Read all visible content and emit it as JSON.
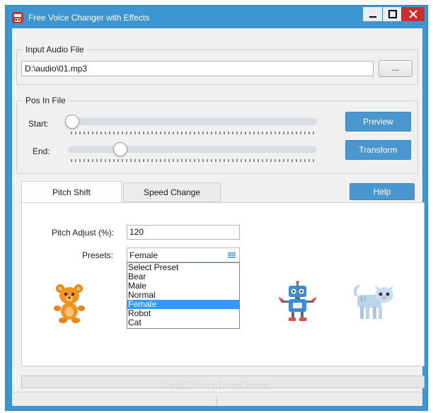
{
  "window": {
    "title": "Free Voice Changer with Effects",
    "accent_color": "#3d95d1"
  },
  "input_group": {
    "title": "Input Audio File",
    "file_path": "D:\\audio\\01.mp3",
    "browse_label": "..."
  },
  "pos_group": {
    "title": "Pos In File",
    "start_label": "Start:",
    "end_label": "End:",
    "start_value": 0.0,
    "end_value": 0.2
  },
  "buttons": {
    "preview": "Preview",
    "transform": "Transform",
    "help": "Help"
  },
  "tabs": [
    {
      "label": "Pitch Shift",
      "active": true
    },
    {
      "label": "Speed Change",
      "active": false
    }
  ],
  "pitch": {
    "adjust_label": "Pitch Adjust (%):",
    "adjust_value": "120",
    "presets_label": "Presets:",
    "selected_preset": "Female",
    "options": [
      "Select Preset",
      "Bear",
      "Male",
      "Normal",
      "Female",
      "Robot",
      "Cat"
    ]
  },
  "icons": [
    "bear-icon",
    "robot-icon",
    "cat-icon"
  ],
  "watermark": "GearDownload.com"
}
